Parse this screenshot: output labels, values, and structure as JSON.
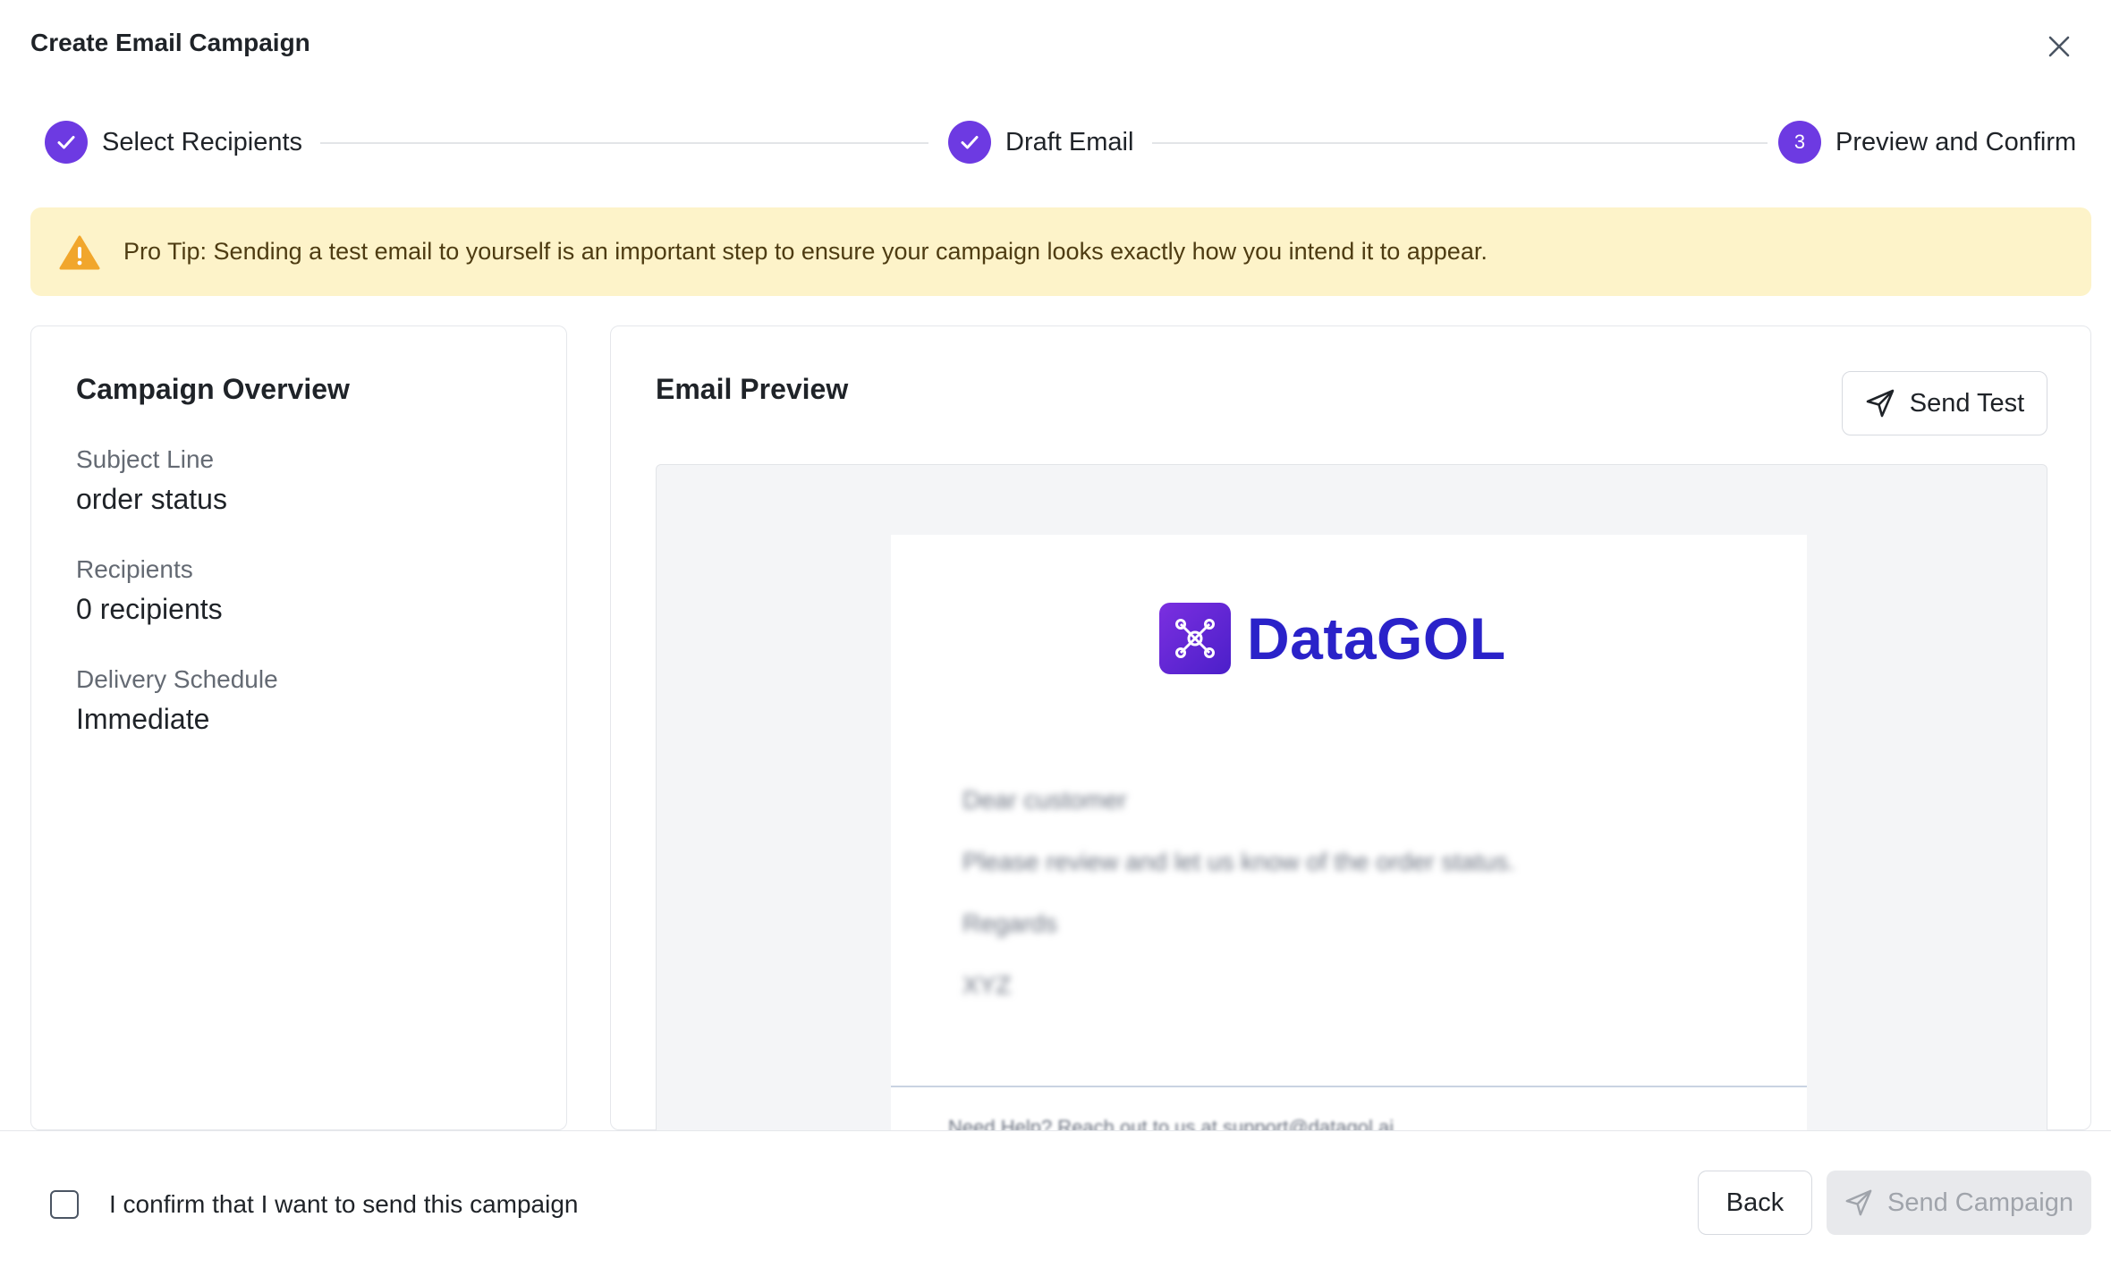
{
  "dialog": {
    "title": "Create Email Campaign"
  },
  "stepper": {
    "steps": [
      {
        "label": "Select Recipients",
        "status": "done"
      },
      {
        "label": "Draft Email",
        "status": "done"
      },
      {
        "label": "Preview and Confirm",
        "status": "active",
        "number": "3"
      }
    ]
  },
  "tip": {
    "text": "Pro Tip: Sending a test email to yourself is an important step to ensure your campaign looks exactly how you intend it to appear."
  },
  "overview": {
    "title": "Campaign Overview",
    "fields": [
      {
        "label": "Subject Line",
        "value": "order status"
      },
      {
        "label": "Recipients",
        "value": "0 recipients"
      },
      {
        "label": "Delivery Schedule",
        "value": "Immediate"
      }
    ]
  },
  "preview": {
    "title": "Email Preview",
    "send_test_label": "Send Test",
    "email": {
      "logo_text": "DataGOL",
      "body_lines": [
        "Dear customer",
        "Please review and let us know of the order status.",
        "Regards",
        "XYZ"
      ],
      "footer": "Need Help? Reach out to us at support@datagol.ai"
    }
  },
  "footer": {
    "confirm_label": "I confirm that I want to send this campaign",
    "back_label": "Back",
    "send_campaign_label": "Send Campaign"
  },
  "colors": {
    "accent": "#6d3ae2",
    "tip_bg": "#fdf3c9",
    "warning": "#f1a62c",
    "logo_blue": "#2a22c9"
  }
}
